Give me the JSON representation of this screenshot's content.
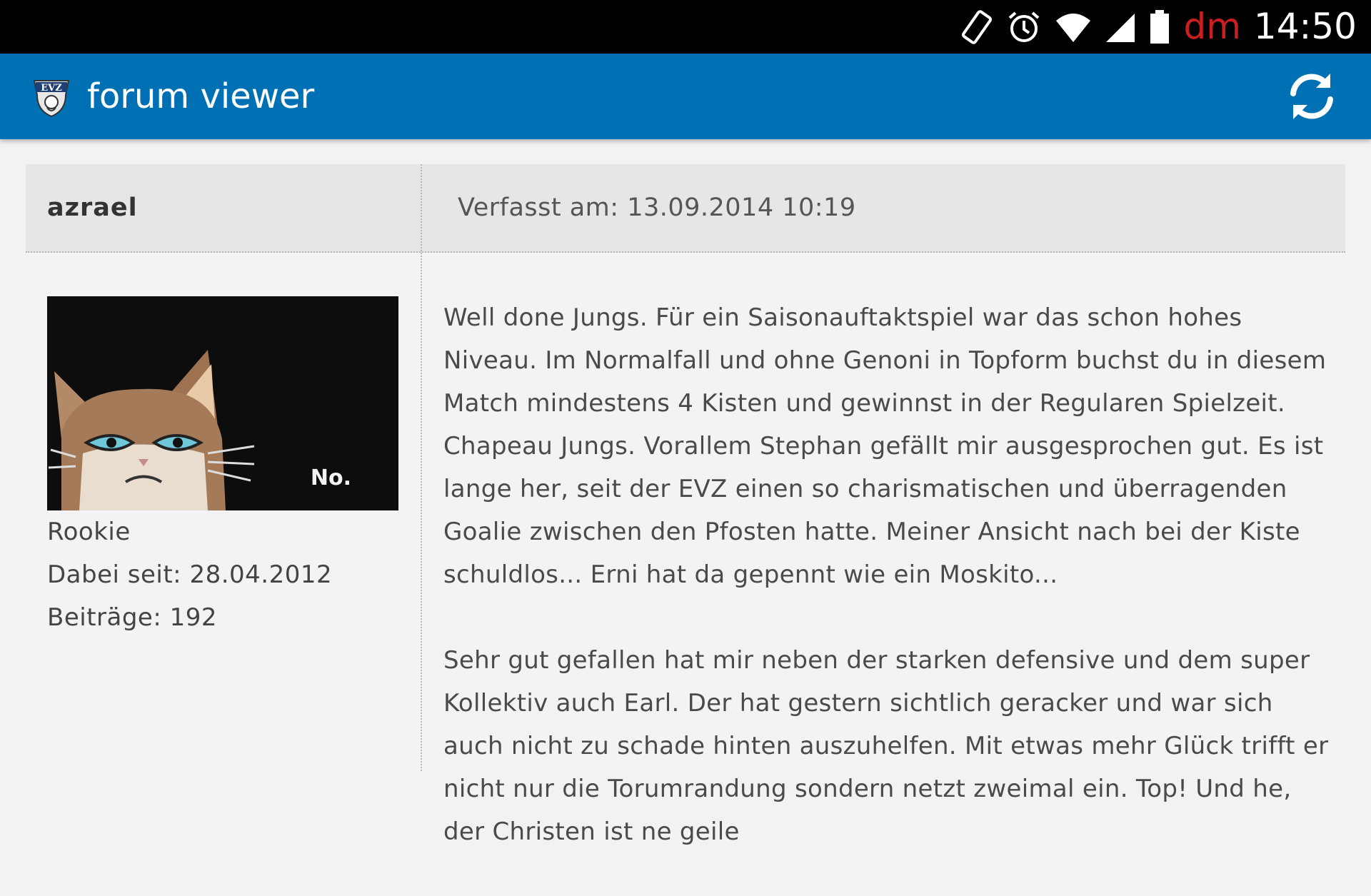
{
  "status_bar": {
    "icons": [
      "rotation-icon",
      "alarm-icon",
      "wifi-icon",
      "signal-icon",
      "battery-icon"
    ],
    "carrier": "dm",
    "time": "14:50",
    "carrier_color": "#cc1e1e"
  },
  "app_bar": {
    "title": "forum viewer",
    "logo_text": "EVZ",
    "background": "#0070b5",
    "refresh_icon": "refresh-icon"
  },
  "post": {
    "author": "azrael",
    "posted": "Verfasst am: 13.09.2014 10:19",
    "avatar": {
      "caption": "No."
    },
    "user": {
      "rank": "Rookie",
      "member_since": "Dabei seit: 28.04.2012",
      "posts": "Beiträge: 192"
    },
    "paragraphs": [
      "Well done Jungs. Für ein Saisonauftaktspiel war das schon hohes Niveau. Im Normalfall und ohne Genoni in Topform buchst du in diesem Match mindestens 4 Kisten und gewinnst in der Regularen Spielzeit. Chapeau Jungs. Vorallem Stephan gefällt mir ausgesprochen gut. Es ist lange her, seit der EVZ einen so charismatischen und überragenden Goalie zwischen den Pfosten hatte. Meiner Ansicht nach bei der Kiste schuldlos... Erni hat da gepennt wie ein Moskito...",
      "Sehr gut gefallen hat mir neben der starken defensive und dem super Kollektiv auch Earl. Der hat gestern sichtlich geracker und war sich auch nicht zu schade hinten auszuhelfen. Mit etwas mehr Glück trifft er nicht nur die Torumrandung sondern netzt zweimal ein. Top! Und he, der Christen ist ne geile"
    ]
  }
}
